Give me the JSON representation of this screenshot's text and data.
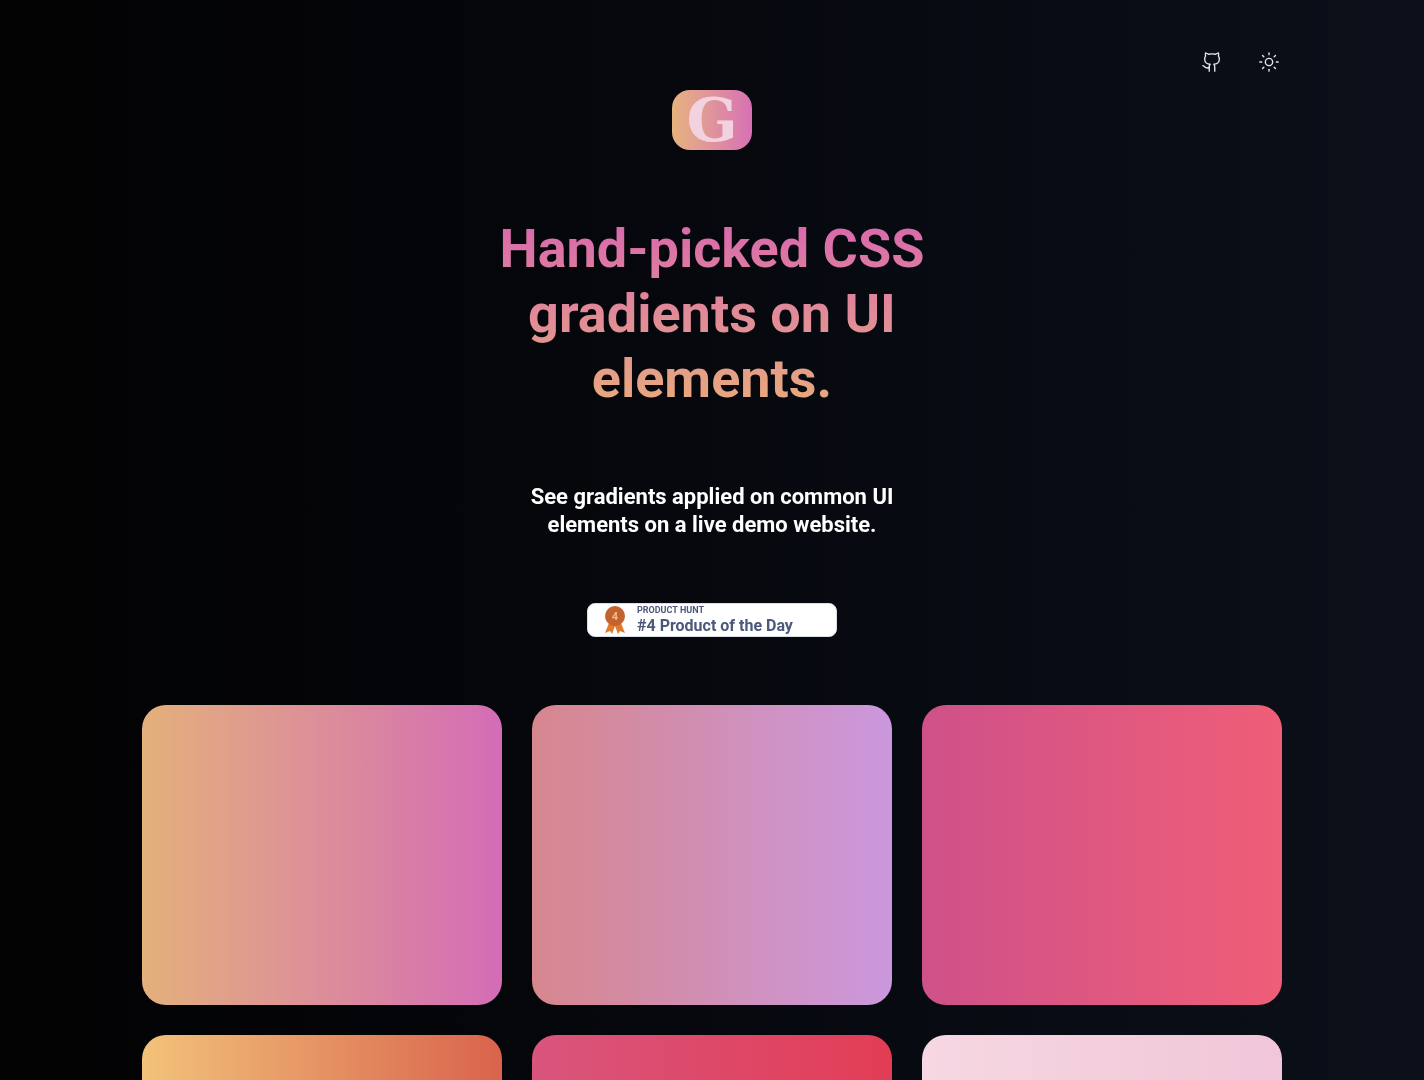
{
  "header": {
    "links": [
      {
        "kind": "github"
      },
      {
        "kind": "theme"
      }
    ]
  },
  "logo": {
    "letter": "G"
  },
  "hero": {
    "title": "Hand-picked CSS gradients on UI elements.",
    "subtitle": "See gradients applied on common UI elements on a live demo website."
  },
  "badge": {
    "rank": "4",
    "eyebrow": "PRODUCT HUNT",
    "label": "#4 Product of the Day"
  },
  "gradients": [
    {
      "stops": [
        {
          "color": "#e4b07c"
        },
        {
          "color": "#d46cb6"
        }
      ]
    },
    {
      "stops": [
        {
          "color": "#d6868d"
        },
        {
          "color": "#cb98de"
        }
      ]
    },
    {
      "stops": [
        {
          "color": "#cf5189"
        },
        {
          "color": "#ef5e78"
        }
      ]
    },
    {
      "stops": [
        {
          "color": "#f2c27a"
        },
        {
          "color": "#d9634c"
        }
      ]
    },
    {
      "stops": [
        {
          "color": "#d9557d"
        },
        {
          "color": "#e23d55"
        }
      ]
    },
    {
      "stops": [
        {
          "color": "#f6d7e2"
        },
        {
          "color": "#f0c6d8"
        }
      ]
    }
  ]
}
